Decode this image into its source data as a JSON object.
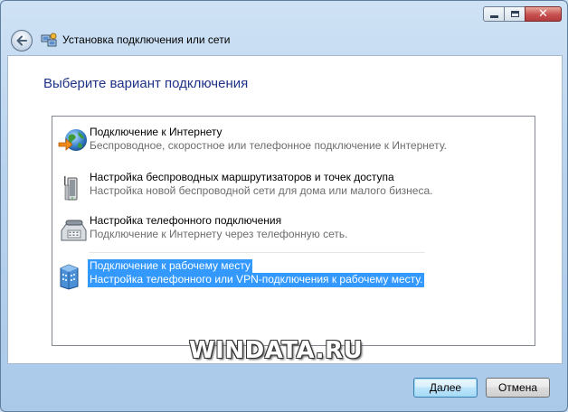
{
  "window": {
    "title": "Установка подключения или сети"
  },
  "titlebar_buttons": {
    "minimize_icon": "minimize-icon",
    "maximize_icon": "maximize-icon",
    "close_icon": "close-icon"
  },
  "main": {
    "heading": "Выберите вариант подключения",
    "options": [
      {
        "title": "Подключение к Интернету",
        "description": "Беспроводное, скоростное или телефонное подключение к Интернету.",
        "icon": "globe-icon",
        "selected": false
      },
      {
        "title": "Настройка беспроводных маршрутизаторов и точек доступа",
        "description": "Настройка новой беспроводной сети для дома или малого бизнеса.",
        "icon": "router-icon",
        "selected": false
      },
      {
        "title": "Настройка телефонного подключения",
        "description": "Подключение к Интернету через телефонную сеть.",
        "icon": "telephone-icon",
        "selected": false
      },
      {
        "title": "Подключение к рабочему месту",
        "description": "Настройка телефонного или VPN-подключения к рабочему месту.",
        "icon": "workplace-icon",
        "selected": true
      }
    ]
  },
  "watermark": "WINDATA.RU",
  "footer": {
    "next_label": "Далее",
    "cancel_label": "Отмена"
  },
  "colors": {
    "heading": "#1e3287",
    "selection": "#3399ff"
  }
}
